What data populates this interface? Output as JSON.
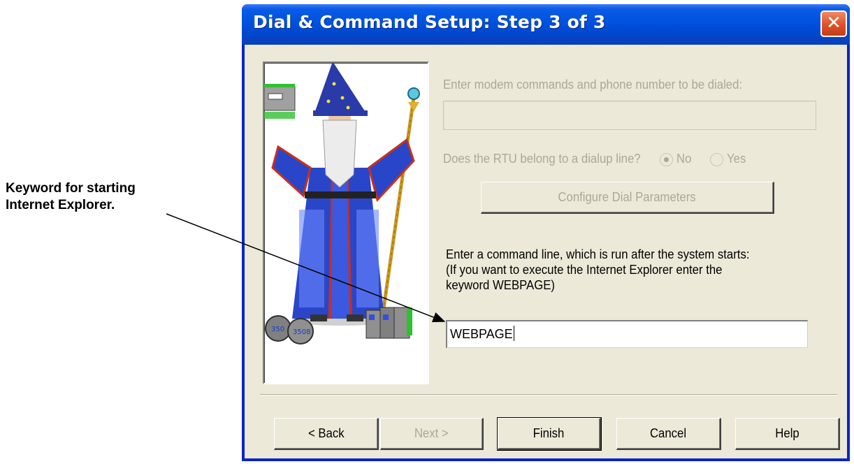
{
  "callout": {
    "line1": "Keyword for starting",
    "line2": "Internet Explorer."
  },
  "window": {
    "title": "Dial & Command Setup: Step 3 of 3",
    "close_glyph": "✕"
  },
  "modem": {
    "label": "Enter modem commands and phone number to be dialed:",
    "value": ""
  },
  "dialup": {
    "question": "Does the RTU belong to a dialup line?",
    "options": [
      {
        "label": "No",
        "selected": true
      },
      {
        "label": "Yes",
        "selected": false
      }
    ]
  },
  "configure_button": "Configure Dial Parameters",
  "command": {
    "label_line1": "Enter a command line, which is run after the system starts:",
    "label_line2": "(If you want to execute the Internet Explorer enter the",
    "label_line3": "keyword WEBPAGE)",
    "value": "WEBPAGE"
  },
  "buttons": {
    "back": "< Back",
    "next": "Next >",
    "finish": "Finish",
    "cancel": "Cancel",
    "help": "Help"
  },
  "colors": {
    "titlebar": "#0053e0",
    "dialog_bg": "#ece9d8",
    "disabled_text": "#aca899",
    "close_button": "#e0552c"
  }
}
